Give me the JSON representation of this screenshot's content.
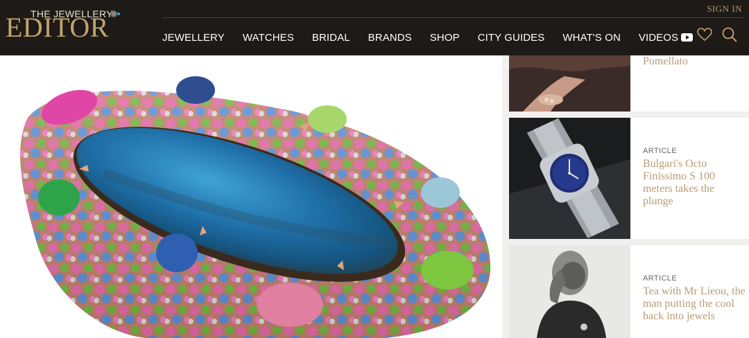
{
  "brand": {
    "logo_top": "THE JEWELLERY",
    "logo_main": "EDITOR"
  },
  "header": {
    "signin": "SIGN IN",
    "nav": [
      "JEWELLERY",
      "WATCHES",
      "BRIDAL",
      "BRANDS",
      "SHOP",
      "CITY GUIDES",
      "WHAT'S ON",
      "VIDEOS"
    ]
  },
  "sidebar": {
    "cards": [
      {
        "kind": "",
        "title": "Pomellato"
      },
      {
        "kind": "ARTICLE",
        "title": "Bulgari's Octo Finissimo S 100 meters takes the plunge"
      },
      {
        "kind": "ARTICLE",
        "title": "Tea with Mr Lieou, the man putting the cool back into jewels"
      }
    ]
  },
  "colors": {
    "header_bg": "#1d1a17",
    "gold": "#b79c75",
    "divider": "#f1f0ee"
  },
  "icons": [
    "youtube-icon",
    "heart-icon",
    "search-icon",
    "gem-icon"
  ]
}
